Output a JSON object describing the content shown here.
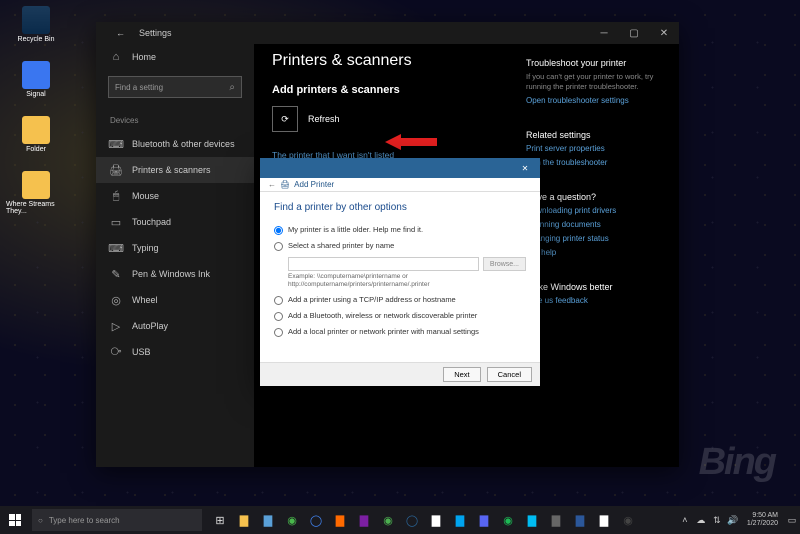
{
  "desktop": {
    "icons": [
      "Recycle Bin",
      "Signal",
      "Folder",
      "Where Streams They..."
    ],
    "watermark": "Bing"
  },
  "settings": {
    "title": "Settings",
    "back_icon": "←",
    "home_label": "Home",
    "search_placeholder": "Find a setting",
    "category": "Devices",
    "sidebar": [
      {
        "icon": "⌨",
        "label": "Bluetooth & other devices"
      },
      {
        "icon": "🖨",
        "label": "Printers & scanners"
      },
      {
        "icon": "🖱",
        "label": "Mouse"
      },
      {
        "icon": "▭",
        "label": "Touchpad"
      },
      {
        "icon": "⌨",
        "label": "Typing"
      },
      {
        "icon": "✎",
        "label": "Pen & Windows Ink"
      },
      {
        "icon": "◎",
        "label": "Wheel"
      },
      {
        "icon": "▷",
        "label": "AutoPlay"
      },
      {
        "icon": "⧂",
        "label": "USB"
      }
    ],
    "page_title": "Printers & scanners",
    "section_title": "Add printers & scanners",
    "refresh_label": "Refresh",
    "not_listed_link": "The printer that I want isn't listed",
    "right": {
      "troubleshoot_head": "Troubleshoot your printer",
      "troubleshoot_text": "If you can't get your printer to work, try running the printer troubleshooter.",
      "troubleshoot_link": "Open troubleshooter settings",
      "related_head": "Related settings",
      "related_links": [
        "Print server properties",
        "Run the troubleshooter"
      ],
      "question_head": "Have a question?",
      "question_links": [
        "Downloading print drivers",
        "Scanning documents",
        "Changing printer status",
        "Get help"
      ],
      "better_head": "Make Windows better",
      "better_link": "Give us feedback"
    }
  },
  "dialog": {
    "crumb_icon": "🖨",
    "crumb": "Add Printer",
    "title": "Find a printer by other options",
    "options": [
      "My printer is a little older. Help me find it.",
      "Select a shared printer by name",
      "Add a printer using a TCP/IP address or hostname",
      "Add a Bluetooth, wireless or network discoverable printer",
      "Add a local printer or network printer with manual settings"
    ],
    "browse_label": "Browse...",
    "example": "Example: \\\\computername\\printername or http://computername/printers/printername/.printer",
    "next_label": "Next",
    "cancel_label": "Cancel"
  },
  "taskbar": {
    "search_placeholder": "Type here to search",
    "time": "9:50 AM",
    "date": "1/27/2020"
  }
}
